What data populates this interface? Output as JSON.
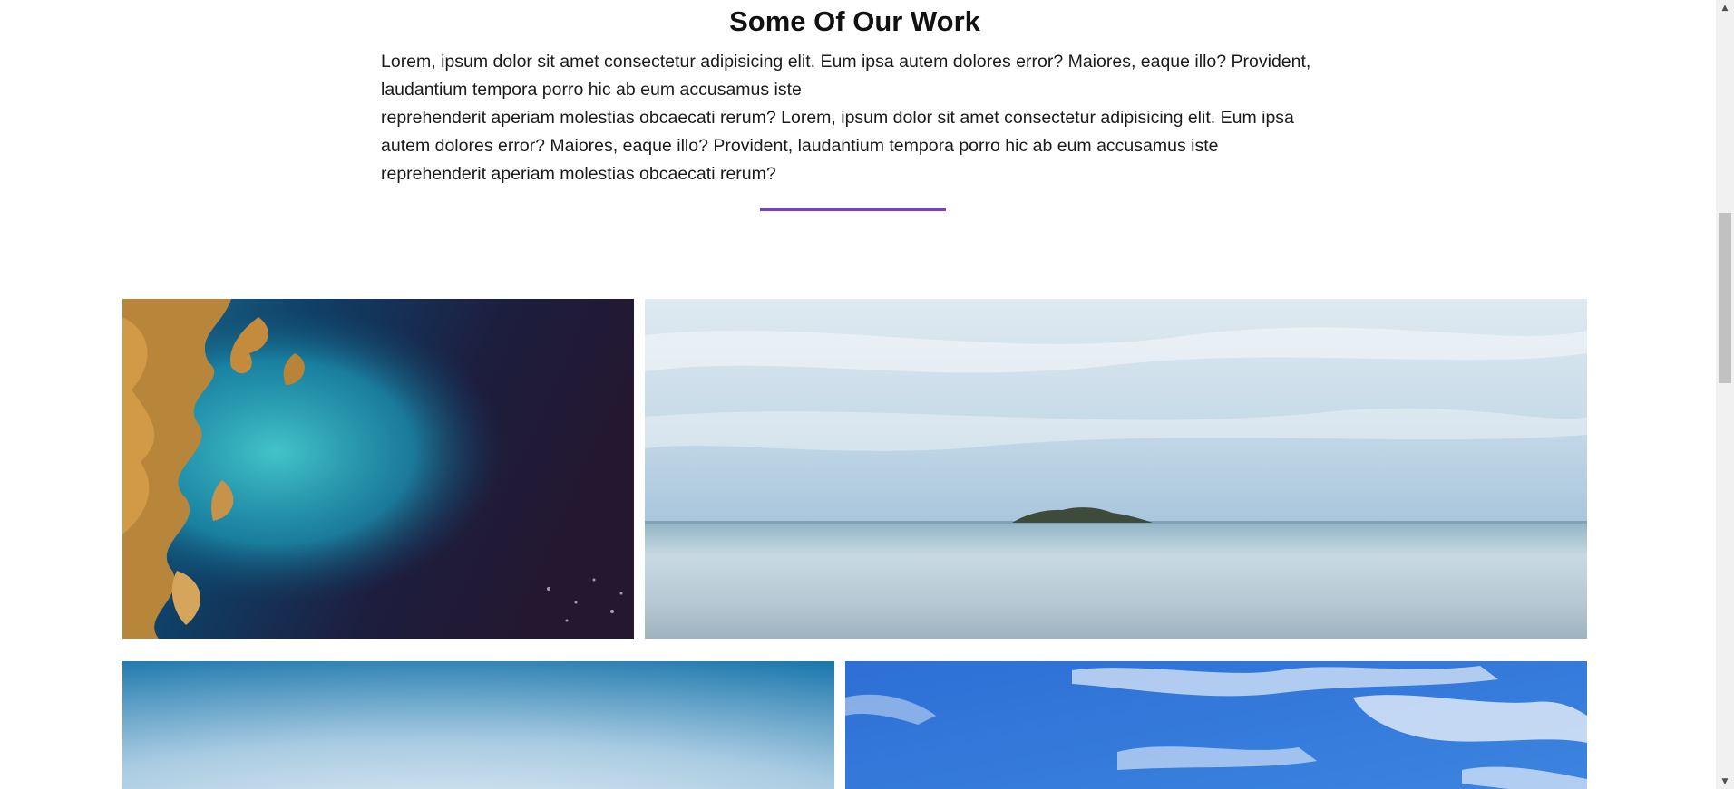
{
  "work_section": {
    "title": "Some Of Our Work",
    "paragraph_1": "Lorem, ipsum dolor sit amet consectetur adipisicing elit. Eum ipsa autem dolores error? Maiores, eaque illo? Provident, laudantium tempora porro hic ab eum accusamus iste",
    "paragraph_2": "reprehenderit aperiam molestias obcaecati rerum? Lorem, ipsum dolor sit amet consectetur adipisicing elit. Eum ipsa autem dolores error? Maiores, eaque illo? Provident, laudantium tempora porro hic ab eum accusamus iste reprehenderit aperiam molestias obcaecati rerum?",
    "accent_color": "#7e3fc7"
  },
  "gallery": {
    "images": [
      {
        "name": "aerial-coastline-satellite-image"
      },
      {
        "name": "calm-sea-island-image"
      },
      {
        "name": "blue-gradient-sky-image"
      },
      {
        "name": "blue-sky-clouds-image"
      }
    ]
  },
  "scrollbar": {
    "up_icon": "chevron-up-icon",
    "down_icon": "chevron-down-icon"
  }
}
